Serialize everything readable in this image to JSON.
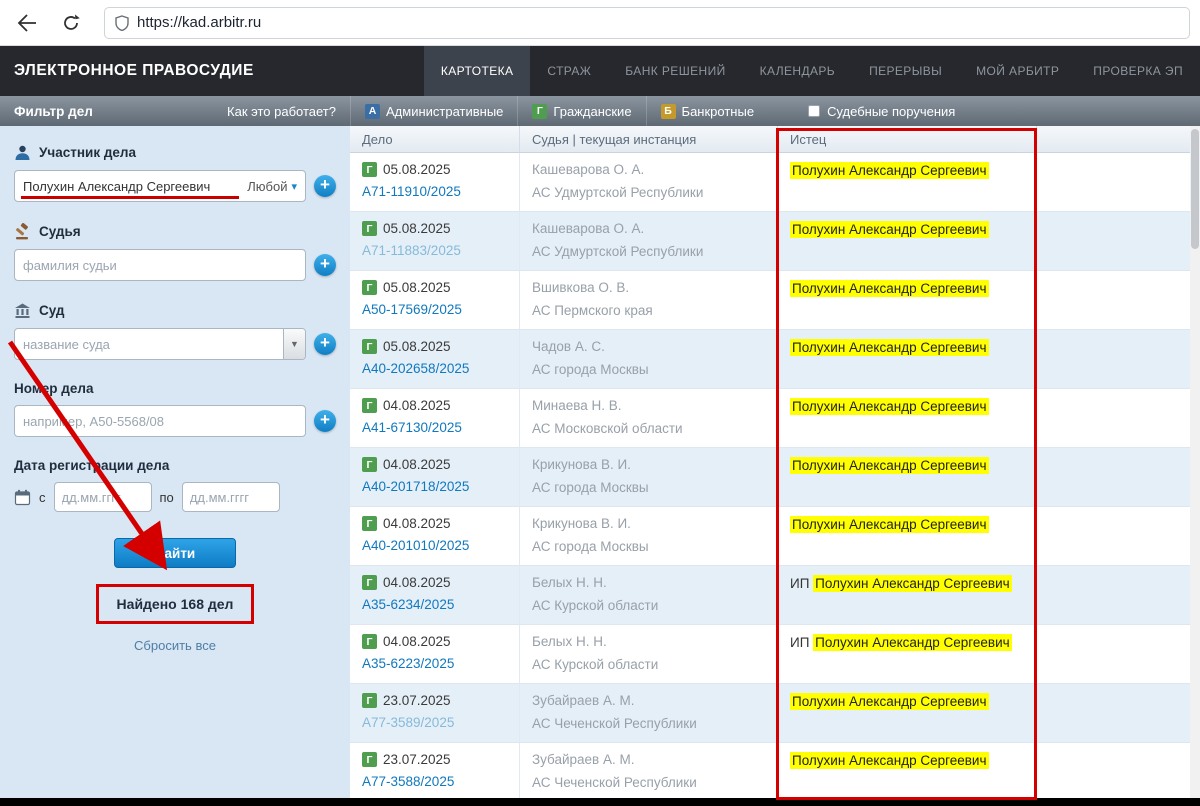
{
  "colors": {
    "accent": "#1586c8",
    "highlight": "#ffff00",
    "annotation": "#d40000",
    "civil_green": "#4f9d4f"
  },
  "browser": {
    "url": "https://kad.arbitr.ru"
  },
  "header": {
    "logo": "ЭЛЕКТРОННОЕ ПРАВОСУДИЕ",
    "nav": [
      {
        "label": "КАРТОТЕКА"
      },
      {
        "label": "СТРАЖ"
      },
      {
        "label": "БАНК РЕШЕНИЙ"
      },
      {
        "label": "КАЛЕНДАРЬ"
      },
      {
        "label": "ПЕРЕРЫВЫ"
      },
      {
        "label": "МОЙ АРБИТР"
      },
      {
        "label": "ПРОВЕРКА ЭП"
      }
    ]
  },
  "subheader": {
    "filter_title": "Фильтр дел",
    "how_it_works": "Как это работает?",
    "case_types": [
      {
        "badge": "А",
        "label": "Административные"
      },
      {
        "badge": "Г",
        "label": "Гражданские"
      },
      {
        "badge": "Б",
        "label": "Банкротные"
      }
    ],
    "checkbox_label": "Судебные поручения"
  },
  "filter": {
    "participant": {
      "label": "Участник дела",
      "value": "Полухин Александр Сергеевич",
      "role": "Любой",
      "caret": "▾"
    },
    "judge": {
      "label": "Судья",
      "placeholder": "фамилия судьи"
    },
    "court": {
      "label": "Суд",
      "placeholder": "название суда",
      "dd_arrow": "▼"
    },
    "case_number": {
      "label": "Номер дела",
      "placeholder": "например, А50-5568/08"
    },
    "reg_date": {
      "label": "Дата регистрации дела",
      "from_label": "с",
      "to_label": "по",
      "placeholder": "дд.мм.гггг"
    },
    "plus": "+",
    "search_button": "Найти",
    "found_text": "Найдено 168 дел",
    "reset_link": "Сбросить все"
  },
  "table": {
    "civil_badge": "Г",
    "headers": [
      "Дело",
      "Судья | текущая инстанция",
      "Истец",
      ""
    ],
    "rows": [
      {
        "date": "05.08.2025",
        "case": "А71-11910/2025",
        "judge": "Кашеварова О. А.",
        "court": "АС Удмуртской Республики",
        "plaintiff_prefix": "",
        "plaintiff": "Полухин Александр Сергеевич",
        "visited": false
      },
      {
        "date": "05.08.2025",
        "case": "А71-11883/2025",
        "judge": "Кашеварова О. А.",
        "court": "АС Удмуртской Республики",
        "plaintiff_prefix": "",
        "plaintiff": "Полухин Александр Сергеевич",
        "visited": true
      },
      {
        "date": "05.08.2025",
        "case": "А50-17569/2025",
        "judge": "Вшивкова О. В.",
        "court": "АС Пермского края",
        "plaintiff_prefix": "",
        "plaintiff": "Полухин Александр Сергеевич",
        "visited": false
      },
      {
        "date": "05.08.2025",
        "case": "А40-202658/2025",
        "judge": "Чадов А. С.",
        "court": "АС города Москвы",
        "plaintiff_prefix": "",
        "plaintiff": "Полухин Александр Сергеевич",
        "visited": false
      },
      {
        "date": "04.08.2025",
        "case": "А41-67130/2025",
        "judge": "Минаева Н. В.",
        "court": "АС Московской области",
        "plaintiff_prefix": "",
        "plaintiff": "Полухин Александр Сергеевич",
        "visited": false
      },
      {
        "date": "04.08.2025",
        "case": "А40-201718/2025",
        "judge": "Крикунова В. И.",
        "court": "АС города Москвы",
        "plaintiff_prefix": "",
        "plaintiff": "Полухин Александр Сергеевич",
        "visited": false
      },
      {
        "date": "04.08.2025",
        "case": "А40-201010/2025",
        "judge": "Крикунова В. И.",
        "court": "АС города Москвы",
        "plaintiff_prefix": "",
        "plaintiff": "Полухин Александр Сергеевич",
        "visited": false
      },
      {
        "date": "04.08.2025",
        "case": "А35-6234/2025",
        "judge": "Белых Н. Н.",
        "court": "АС Курской области",
        "plaintiff_prefix": "ИП ",
        "plaintiff": "Полухин Александр Сергеевич",
        "visited": false
      },
      {
        "date": "04.08.2025",
        "case": "А35-6223/2025",
        "judge": "Белых Н. Н.",
        "court": "АС Курской области",
        "plaintiff_prefix": "ИП ",
        "plaintiff": "Полухин Александр Сергеевич",
        "visited": false
      },
      {
        "date": "23.07.2025",
        "case": "А77-3589/2025",
        "judge": "Зубайраев А. М.",
        "court": "АС Чеченской Республики",
        "plaintiff_prefix": "",
        "plaintiff": "Полухин Александр Сергеевич",
        "visited": true
      },
      {
        "date": "23.07.2025",
        "case": "А77-3588/2025",
        "judge": "Зубайраев А. М.",
        "court": "АС Чеченской Республики",
        "plaintiff_prefix": "",
        "plaintiff": "Полухин Александр Сергеевич",
        "visited": false
      }
    ]
  }
}
